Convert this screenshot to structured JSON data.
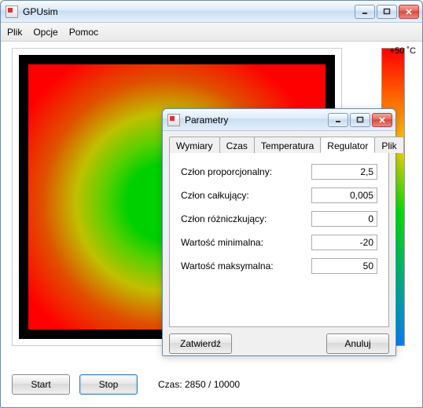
{
  "main": {
    "title": "GPUsim",
    "menu": {
      "file": "Plik",
      "options": "Opcje",
      "help": "Pomoc"
    },
    "legend_top": "+50 ˚C",
    "start_label": "Start",
    "stop_label": "Stop",
    "time_label": "Czas: 2850 / 10000"
  },
  "dialog": {
    "title": "Parametry",
    "tabs": {
      "dim": "Wymiary",
      "time": "Czas",
      "temp": "Temperatura",
      "reg": "Regulator",
      "file": "Plik"
    },
    "fields": {
      "p_label": "Człon proporcjonalny:",
      "p_value": "2,5",
      "i_label": "Człon całkujący:",
      "i_value": "0,005",
      "d_label": "Człon różniczkujący:",
      "d_value": "0",
      "min_label": "Wartość minimalna:",
      "min_value": "-20",
      "max_label": "Wartość maksymalna:",
      "max_value": "50"
    },
    "confirm": "Zatwierdź",
    "cancel": "Anuluj"
  }
}
